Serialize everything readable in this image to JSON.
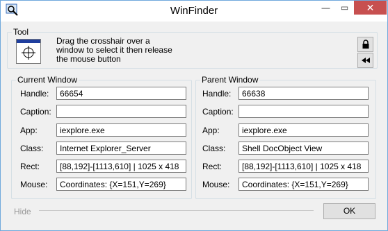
{
  "window": {
    "title": "WinFinder",
    "minimize_glyph": "—",
    "maximize_glyph": "▭",
    "close_glyph": "✕",
    "icon": "magnifier-app-icon"
  },
  "tool": {
    "legend": "Tool",
    "instruction_line1": "Drag the crosshair over a",
    "instruction_line2": "window to select it then release",
    "instruction_line3": "the mouse button",
    "lock_glyph": "🔒",
    "rewind_glyph": "◀◀"
  },
  "labels": {
    "handle": "Handle:",
    "caption": "Caption:",
    "app": "App:",
    "class": "Class:",
    "rect": "Rect:",
    "mouse": "Mouse:"
  },
  "current": {
    "legend": "Current Window",
    "handle": "66654",
    "caption": "",
    "app": "iexplore.exe",
    "class": "Internet Explorer_Server",
    "rect": "[88,192]-[1113,610] | 1025 x 418",
    "mouse": "Coordinates: {X=151,Y=269}"
  },
  "parent": {
    "legend": "Parent Window",
    "handle": "66638",
    "caption": "",
    "app": "iexplore.exe",
    "class": "Shell DocObject View",
    "rect": "[88,192]-[1113,610] | 1025 x 418",
    "mouse": "Coordinates: {X=151,Y=269}"
  },
  "footer": {
    "hide_label": "Hide",
    "ok_label": "OK"
  }
}
